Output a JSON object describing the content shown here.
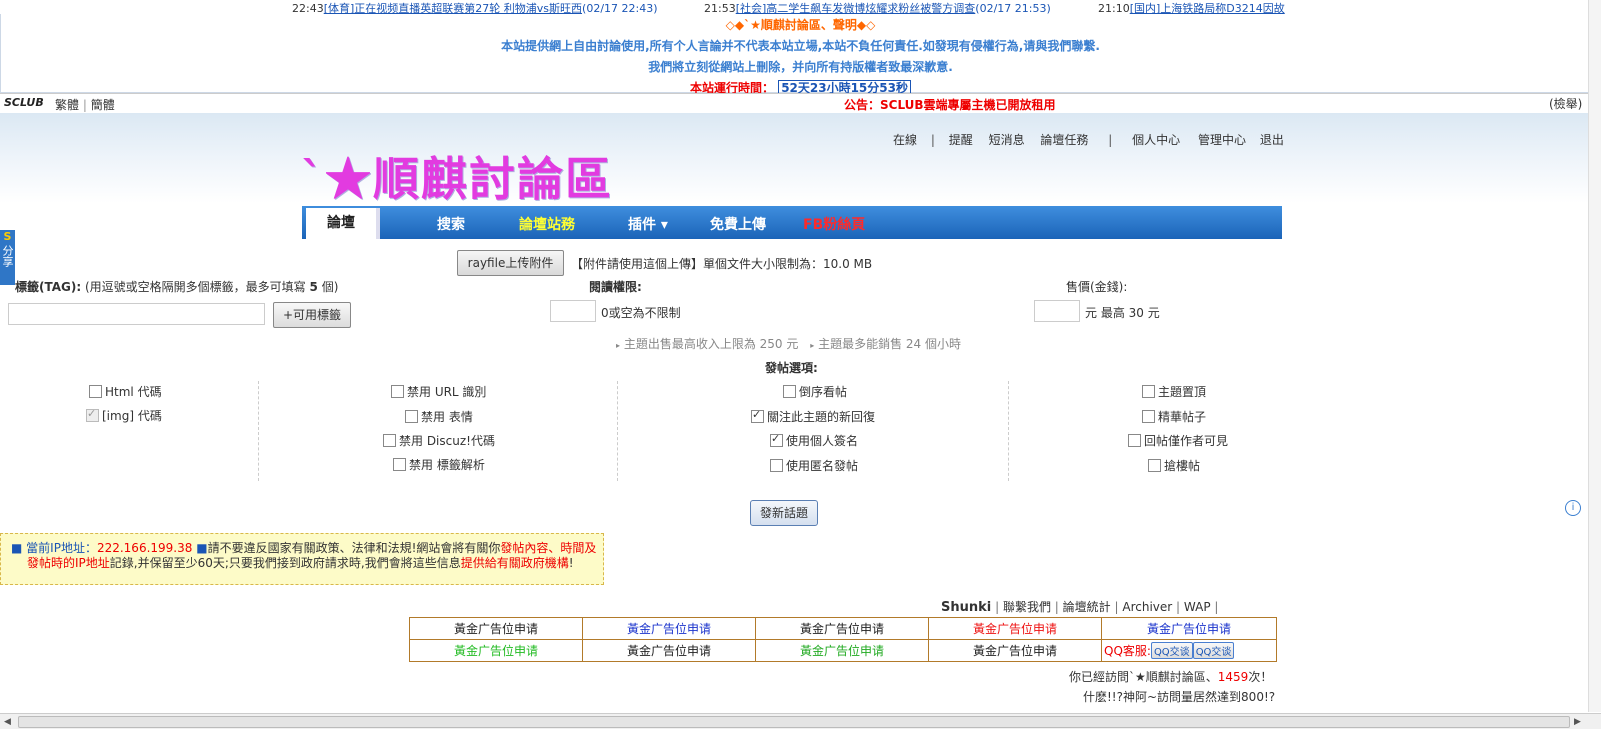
{
  "ticker": [
    {
      "time": "22:43",
      "text": "[体育]正在视频直播英超联赛第27轮 利物浦vs斯旺西",
      "date": "(02/17 22:43)"
    },
    {
      "time": "21:53",
      "text": "[社会]高二学生飙车发微博炫耀求粉丝被警方调查",
      "date": "(02/17 21:53)"
    },
    {
      "time": "21:10",
      "text": "[国内]上海铁路局称D3214因故",
      "date": ""
    }
  ],
  "notice": {
    "title": "◇◆`★順麒討論區、聲明◆◇",
    "line1": "本站提供網上自由討論使用,所有个人言論并不代表本站立場,本站不負任何責任.如發現有侵權行為,请與我們聯繫.",
    "line2": "我們將立刻從網站上刪除，并向所有持版權者致最深歉意.",
    "runtime_label": "本站運行時間：",
    "runtime_value": "52天23小時15分53秒"
  },
  "topbar": {
    "brand": "SCLUB",
    "lang_trad": "繁體",
    "lang_simp": "簡體",
    "announcement": "公告：SCLUB雲端專屬主機已開放租用",
    "search": "(檢舉)"
  },
  "header": {
    "logo": "`★順麒討論區",
    "user_nav": [
      "在線",
      "提醒",
      "短消息",
      "論壇任務",
      "個人中心",
      "管理中心",
      "退出"
    ]
  },
  "mainnav": {
    "current": "論壇",
    "items": [
      {
        "label": "搜索",
        "color": "#ffffff"
      },
      {
        "label": "論壇站務",
        "color": "#ffff33"
      },
      {
        "label": "插件 ▾",
        "color": "#ffffff"
      },
      {
        "label": "免費上傳",
        "color": "#ffffff"
      },
      {
        "label": "FB粉絲頁",
        "color": "#ff2a2a"
      }
    ]
  },
  "upload": {
    "button": "rayfile上传附件",
    "info": "【附件請使用這個上傳】單個文件大小限制為：10.0 MB"
  },
  "tag": {
    "label": "標籤(TAG):",
    "hint": "(用逗號或空格隔開多個標籤，最多可填寫",
    "count": "5",
    "hint_end": "個)",
    "value": "",
    "button": "+可用標籤"
  },
  "read_perm": {
    "label": "閱讀權限:",
    "value": "",
    "hint": "0或空為不限制"
  },
  "price": {
    "label": "售價(金錢):",
    "value": "",
    "unit": "元",
    "max": "最高 30 元"
  },
  "limits": {
    "income": "主題出售最高收入上限為 250 元",
    "hours": "主題最多能銷售 24 個小時"
  },
  "options": {
    "title": "發帖選項:",
    "col1": [
      {
        "label": "Html 代碼",
        "checked": false,
        "disabled": false
      },
      {
        "label": "[img] 代碼",
        "checked": true,
        "disabled": true
      }
    ],
    "col2": [
      {
        "label": "禁用 URL 識別",
        "checked": false,
        "disabled": false
      },
      {
        "label": "禁用 表情",
        "checked": false,
        "disabled": false
      },
      {
        "label": "禁用 Discuz!代碼",
        "checked": false,
        "disabled": false
      },
      {
        "label": "禁用 標籤解析",
        "checked": false,
        "disabled": false
      }
    ],
    "col3": [
      {
        "label": "倒序看帖",
        "checked": false,
        "disabled": false
      },
      {
        "label": "關注此主題的新回復",
        "checked": true,
        "disabled": false
      },
      {
        "label": "使用個人簽名",
        "checked": true,
        "disabled": false
      },
      {
        "label": "使用匿名發帖",
        "checked": false,
        "disabled": false
      }
    ],
    "col4": [
      {
        "label": "主題置頂",
        "checked": false,
        "disabled": false
      },
      {
        "label": "精華帖子",
        "checked": false,
        "disabled": false
      },
      {
        "label": "回帖僅作者可見",
        "checked": false,
        "disabled": false
      },
      {
        "label": "搶樓帖",
        "checked": false,
        "disabled": false
      }
    ]
  },
  "submit": "發新話題",
  "ipbox": {
    "prefix": "當前IP地址：",
    "ip": "222.166.199.38",
    "t1": "請不要違反國家有關政策、法律和法規!網站會將有關你",
    "r1": "發帖內容、時間及",
    "r2": "發帖時的IP地址",
    "t2": "記錄,并保留至少60天;只要我們接到政府請求時,我們會將這些信息",
    "r3": "提供給有關政府機構",
    "t3": "!"
  },
  "footer": {
    "brand": "Shunki",
    "links": [
      "聯繫我們",
      "論壇統計",
      "Archiver",
      "WAP"
    ]
  },
  "ads": {
    "row1": [
      {
        "text": "黃金广告位申请",
        "color": "#222222"
      },
      {
        "text": "黃金广告位申请",
        "color": "#1a33cc"
      },
      {
        "text": "黃金广告位申请",
        "color": "#222222"
      },
      {
        "text": "黃金广告位申请",
        "color": "#ee1111"
      },
      {
        "text": "黃金广告位申请",
        "color": "#1a33cc"
      }
    ],
    "row2": [
      {
        "text": "黃金广告位申请",
        "color": "#22bb22"
      },
      {
        "text": "黃金广告位申请",
        "color": "#222222"
      },
      {
        "text": "黃金广告位申请",
        "color": "#22aa22"
      },
      {
        "text": "黃金广告位申请",
        "color": "#222222"
      }
    ],
    "qq_label": "QQ客服:",
    "qq_button": "QQ交谈"
  },
  "visit": {
    "line1_a": "你已經訪問`★順麒討論區、",
    "count": "1459",
    "line1_b": "次！",
    "line2": "什麽!!?神阿~訪問量居然達到800!?"
  },
  "share": "分享"
}
